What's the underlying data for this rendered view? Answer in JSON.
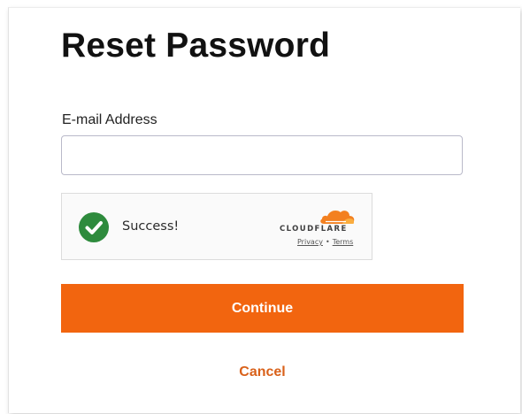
{
  "form": {
    "title": "Reset Password",
    "email_label": "E-mail Address",
    "email_value": "",
    "continue_label": "Continue",
    "cancel_label": "Cancel"
  },
  "captcha": {
    "status_text": "Success!",
    "status_icon": "check-circle-icon",
    "brand_name": "CLOUDFLARE",
    "brand_logo": "cloudflare-cloud-logo",
    "privacy_link": "Privacy",
    "separator": "•",
    "terms_link": "Terms"
  },
  "colors": {
    "accent": "#f2650f",
    "cancel": "#d9611a",
    "success": "#2e8b3d",
    "cloudflare_orange": "#f38020"
  }
}
